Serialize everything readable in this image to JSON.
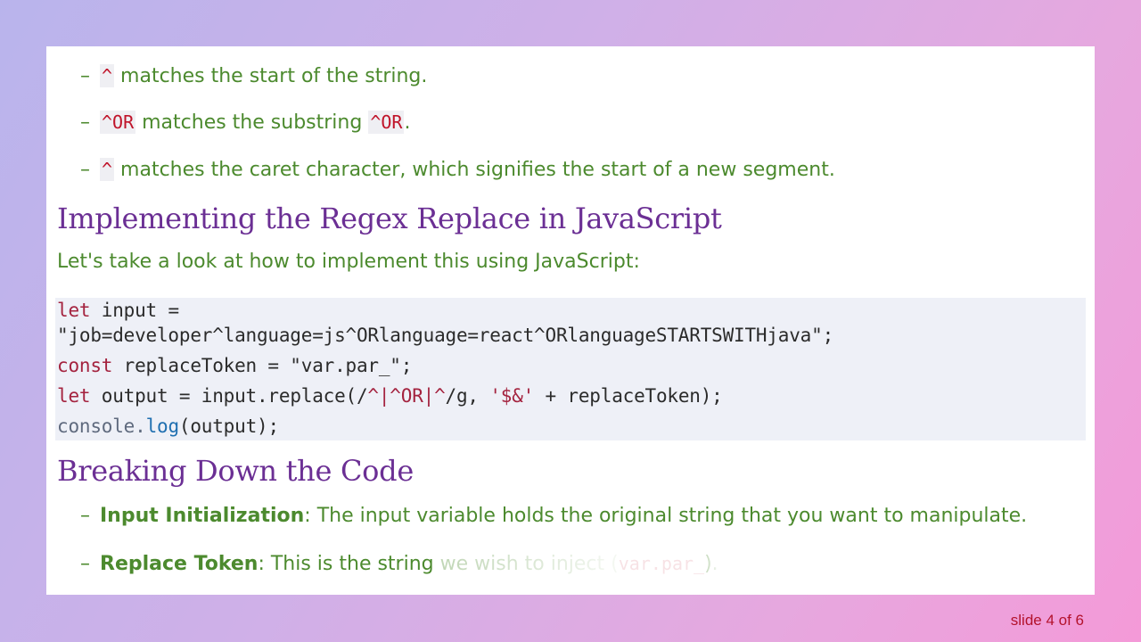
{
  "bullets_top": [
    {
      "code": "^",
      "text": " matches the start of the string."
    },
    {
      "code": "^OR",
      "text": " matches the substring ",
      "code2": "^OR",
      "tail": "."
    },
    {
      "code": "^",
      "text": " matches the caret character, which signifies the start of a new segment."
    }
  ],
  "heading1": "Implementing the Regex Replace in JavaScript",
  "intro": "Let's take a look at how to implement this using JavaScript:",
  "code": {
    "line1a_kw": "let",
    "line1a_rest": " input =",
    "line1b": "\"job=developer^language=js^ORlanguage=react^ORlanguageSTARTSWITHjava\";",
    "line2_kw": "const",
    "line2_rest": " replaceToken = \"var.par_\";",
    "line3_kw": "let",
    "line3_a": " output = input.replace(/",
    "line3_regex": "^|^OR|^",
    "line3_b": "/g, ",
    "line3_str": "'$&'",
    "line3_c": " + replaceToken);",
    "line4_obj": "console",
    "line4_dot": ".",
    "line4_fn": "log",
    "line4_rest": "(output);"
  },
  "heading2": "Breaking Down the Code",
  "bullets_bottom": [
    {
      "label": "Input Initialization",
      "text": ": The input variable holds the original string that you want to manipulate."
    },
    {
      "label": "Replace Token",
      "text": ": This is the string ",
      "faded": "we wish to inject (",
      "faded_code": "var.par_",
      "faded_tail": ")."
    }
  ],
  "footer": "slide 4 of 6",
  "colors": {
    "heading": "#6b2f94",
    "body_text": "#4c8a2e",
    "inline_code": "#c0142a",
    "footer": "#b3122c"
  }
}
